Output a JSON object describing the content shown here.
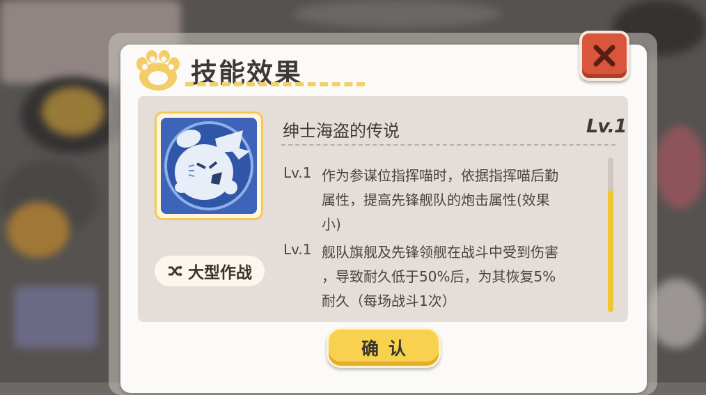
{
  "dialog": {
    "title": "技能效果",
    "close_icon": "close-x-icon"
  },
  "skill": {
    "name": "绅士海盗的传说",
    "level_badge": "Lv.1",
    "icon": "pirate-cat-skill-icon",
    "tag_label": "大型作战",
    "tag_icon": "shuffle-icon",
    "descriptions": [
      {
        "level": "Lv.1",
        "lines": [
          "作为参谋位指挥喵时，依据指挥喵后勤",
          "属性，提高先锋舰队的炮击属性(效果",
          "小)"
        ]
      },
      {
        "level": "Lv.1",
        "lines": [
          "舰队旗舰及先锋领舰在战斗中受到伤害",
          "，导致耐久低于50%后，为其恢复5%",
          "耐久（每场战斗1次）"
        ]
      }
    ]
  },
  "buttons": {
    "confirm_label": "确认"
  },
  "colors": {
    "accent_yellow": "#f8d24f",
    "close_red": "#d9553b",
    "panel": "#e5ded8"
  }
}
